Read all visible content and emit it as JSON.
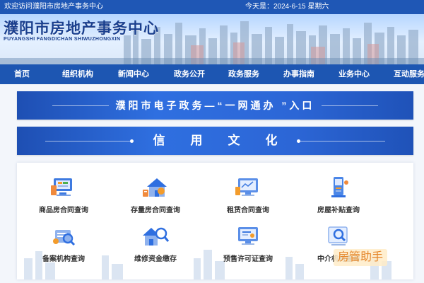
{
  "topbar": {
    "welcome": "欢迎访问濮阳市房地产事务中心",
    "date": "今天是：2024-6-15 星期六"
  },
  "header": {
    "title": "濮阳市房地产事务中心",
    "subtitle": "PUYANGSHI FANGDICHAN SHIWUZHONGXIN"
  },
  "nav": {
    "items": [
      "首页",
      "组织机构",
      "新闻中心",
      "政务公开",
      "政务服务",
      "办事指南",
      "业务中心",
      "互动服务"
    ]
  },
  "banners": {
    "egov": "濮阳市电子政务—“一网通办 ”入口",
    "credit": "信用文化"
  },
  "services": {
    "items": [
      {
        "label": "商品房合同查询",
        "icon": "contract-screen-icon"
      },
      {
        "label": "存量房合同查询",
        "icon": "house-contract-icon"
      },
      {
        "label": "租赁合同查询",
        "icon": "lease-monitor-icon"
      },
      {
        "label": "房屋补贴查询",
        "icon": "subsidy-kiosk-icon"
      },
      {
        "label": "备案机构查询",
        "icon": "agency-search-icon"
      },
      {
        "label": "维修资金缴存",
        "icon": "house-magnifier-icon"
      },
      {
        "label": "预售许可证查询",
        "icon": "presale-license-icon"
      },
      {
        "label": "中介机构查询",
        "icon": "intermediary-search-icon"
      }
    ]
  },
  "watermark": {
    "text": "房管助手"
  },
  "colors": {
    "brand_blue": "#1d56b2",
    "title_blue": "#1a3f8e",
    "panel_bg": "#ffffff",
    "watermark": "#e5862a"
  }
}
